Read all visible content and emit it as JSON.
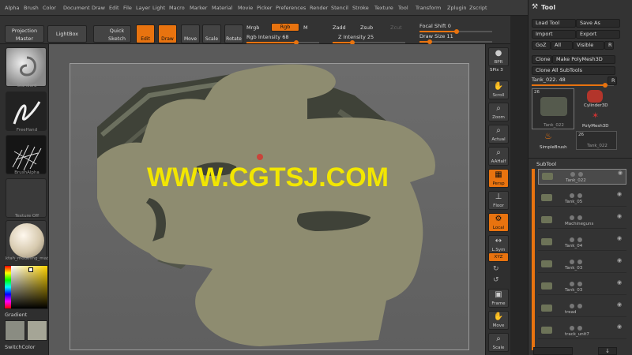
{
  "menu": [
    "Alpha",
    "Brush",
    "Color",
    "Document",
    "Draw",
    "Edit",
    "File",
    "Layer",
    "Light",
    "Macro",
    "Marker",
    "Material",
    "Movie",
    "Picker",
    "Preferences",
    "Render",
    "Stencil",
    "Stroke",
    "Texture",
    "Tool",
    "Transform",
    "Zplugin",
    "Zscript"
  ],
  "toolbar": {
    "projection_master": "Projection Master",
    "lightbox": "LightBox",
    "quick_sketch": "Quick Sketch",
    "edit": "Edit",
    "draw": "Draw",
    "move": "Move",
    "scale": "Scale",
    "rotate": "Rotate",
    "mrgb": "Mrgb",
    "rgb": "Rgb",
    "m": "M",
    "rgb_intensity": "Rgb Intensity 68",
    "zadd": "Zadd",
    "zsub": "Zsub",
    "zcut": "Zcut",
    "z_intensity": "Z Intensity 25",
    "focal_shift": "Focal Shift 0",
    "draw_size": "Draw Size 11"
  },
  "left_shelf": {
    "standard": "Standard",
    "freehand": "FreeHand",
    "brush_alpha": "BrushAlpha",
    "texture_off": "Texture Off",
    "material": "ktah_modeling_mat",
    "gradient": "Gradient",
    "switch_color": "SwitchColor"
  },
  "right_shelf": [
    {
      "label": "BPR"
    },
    {
      "label": "SPix 3"
    },
    {
      "label": "Scroll"
    },
    {
      "label": "Zoom"
    },
    {
      "label": "Actual"
    },
    {
      "label": "AAHalf"
    },
    {
      "label": "Persp"
    },
    {
      "label": "Floor"
    },
    {
      "label": "Local"
    },
    {
      "label": "L.Sym"
    },
    {
      "label": "XYZ"
    },
    {
      "label": "Frame"
    },
    {
      "label": "Move"
    },
    {
      "label": "Scale"
    }
  ],
  "tool_panel": {
    "title": "Tool",
    "load_tool": "Load Tool",
    "save_as": "Save As",
    "import": "Import",
    "export": "Export",
    "goz": "GoZ",
    "all": "All",
    "visible": "Visible",
    "r": "R",
    "clone": "Clone",
    "make_polymesh": "Make PolyMesh3D",
    "clone_all": "Clone All SubTools",
    "current_tool": "Tank_022. 48",
    "thumb_count_a": "26",
    "thumb_count_b": "26",
    "tool_tank": "Tank_022",
    "tool_cylinder": "Cylinder3D",
    "tool_polymesh": "PolyMesh3D",
    "tool_simplebrush": "SimpleBrush",
    "tool_tank2": "Tank_022",
    "subtool_header": "SubTool",
    "subtools": [
      "Tank_022",
      "Tank_05",
      "Machineguns",
      "Tank_04",
      "Tank_03",
      "Tank_03",
      "tread",
      "track_unit7"
    ]
  },
  "watermark": "WWW.CGTSJ.COM",
  "colors": {
    "accent": "#e8730f",
    "watermark": "#f2e600",
    "model_clay": "#8e8c70"
  }
}
